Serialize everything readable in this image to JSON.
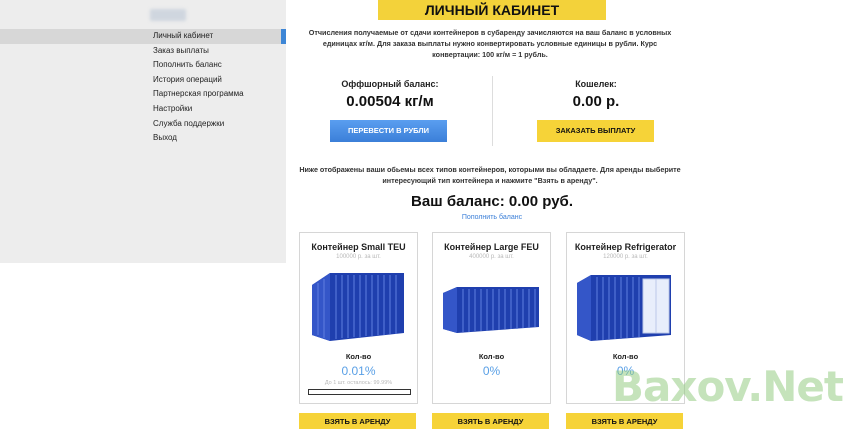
{
  "header": {
    "title": "ЛИЧНЫЙ КАБИНЕТ"
  },
  "sidebar": {
    "items": [
      {
        "label": "Личный кабинет",
        "active": true
      },
      {
        "label": "Заказ выплаты"
      },
      {
        "label": "Пополнить баланс"
      },
      {
        "label": "История операций"
      },
      {
        "label": "Партнерская программа"
      },
      {
        "label": "Настройки"
      },
      {
        "label": "Служба поддержки"
      },
      {
        "label": "Выход"
      }
    ]
  },
  "intro": "Отчисления получаемые от сдачи контейнеров в субаренду зачисляются на ваш баланс в условных единицах кг/м. Для заказа выплаты нужно конвертировать условные единицы в рубли. Курс конвертации: 100 кг/м = 1 рубль.",
  "offshore": {
    "label": "Оффшорный баланс:",
    "value": "0.00504 кг/м",
    "button": "ПЕРЕВЕСТИ В РУБЛИ"
  },
  "wallet": {
    "label": "Кошелек:",
    "value": "0.00 р.",
    "button": "ЗАКАЗАТЬ ВЫПЛАТУ"
  },
  "info": "Ниже отображены ваши обьемы всех типов контейнеров, которыми вы обладаете. Для аренды выберите интересующий тип контейнера и нажмите \"Взять в аренду\".",
  "your_balance": "Ваш баланс: 0.00 руб.",
  "topup_link": "Пополнить баланс",
  "cards": [
    {
      "title": "Контейнер Small TEU",
      "price": "100000 р. за шт.",
      "qty_label": "Кол-во",
      "qty_value": "0.01%",
      "note": "До 1 шт. осталось: 99.99%",
      "progress": 0.0001,
      "button": "ВЗЯТЬ В АРЕНДУ"
    },
    {
      "title": "Контейнер Large FEU",
      "price": "400000 р. за шт.",
      "qty_label": "Кол-во",
      "qty_value": "0%",
      "button": "ВЗЯТЬ В АРЕНДУ"
    },
    {
      "title": "Контейнер Refrigerator",
      "price": "120000 р. за шт.",
      "qty_label": "Кол-во",
      "qty_value": "0%",
      "button": "ВЗЯТЬ В АРЕНДУ"
    }
  ],
  "watermark": "Baxov.Net",
  "colors": {
    "accent_yellow": "#f6d338",
    "accent_blue": "#3b7fd8",
    "container_blue": "#2b4fc2"
  }
}
